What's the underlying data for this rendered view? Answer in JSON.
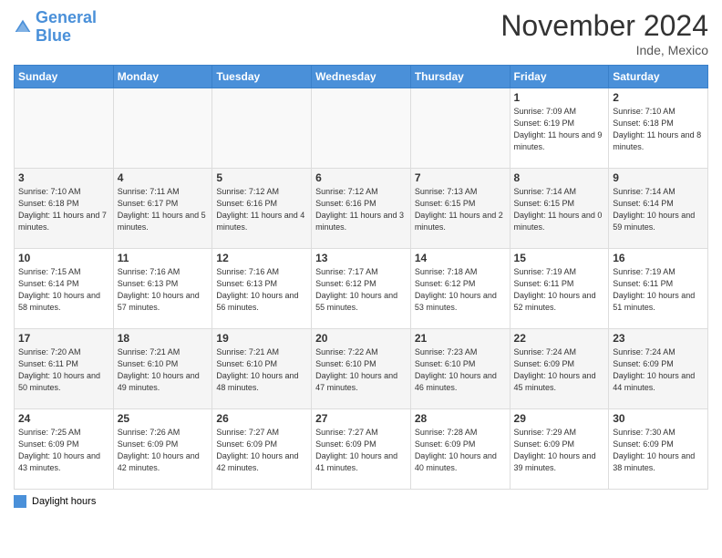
{
  "header": {
    "logo_line1": "General",
    "logo_line2": "Blue",
    "title": "November 2024",
    "location": "Inde, Mexico"
  },
  "days_of_week": [
    "Sunday",
    "Monday",
    "Tuesday",
    "Wednesday",
    "Thursday",
    "Friday",
    "Saturday"
  ],
  "weeks": [
    {
      "days": [
        {
          "num": "",
          "info": ""
        },
        {
          "num": "",
          "info": ""
        },
        {
          "num": "",
          "info": ""
        },
        {
          "num": "",
          "info": ""
        },
        {
          "num": "",
          "info": ""
        },
        {
          "num": "1",
          "info": "Sunrise: 7:09 AM\nSunset: 6:19 PM\nDaylight: 11 hours and 9 minutes."
        },
        {
          "num": "2",
          "info": "Sunrise: 7:10 AM\nSunset: 6:18 PM\nDaylight: 11 hours and 8 minutes."
        }
      ]
    },
    {
      "days": [
        {
          "num": "3",
          "info": "Sunrise: 7:10 AM\nSunset: 6:18 PM\nDaylight: 11 hours and 7 minutes."
        },
        {
          "num": "4",
          "info": "Sunrise: 7:11 AM\nSunset: 6:17 PM\nDaylight: 11 hours and 5 minutes."
        },
        {
          "num": "5",
          "info": "Sunrise: 7:12 AM\nSunset: 6:16 PM\nDaylight: 11 hours and 4 minutes."
        },
        {
          "num": "6",
          "info": "Sunrise: 7:12 AM\nSunset: 6:16 PM\nDaylight: 11 hours and 3 minutes."
        },
        {
          "num": "7",
          "info": "Sunrise: 7:13 AM\nSunset: 6:15 PM\nDaylight: 11 hours and 2 minutes."
        },
        {
          "num": "8",
          "info": "Sunrise: 7:14 AM\nSunset: 6:15 PM\nDaylight: 11 hours and 0 minutes."
        },
        {
          "num": "9",
          "info": "Sunrise: 7:14 AM\nSunset: 6:14 PM\nDaylight: 10 hours and 59 minutes."
        }
      ]
    },
    {
      "days": [
        {
          "num": "10",
          "info": "Sunrise: 7:15 AM\nSunset: 6:14 PM\nDaylight: 10 hours and 58 minutes."
        },
        {
          "num": "11",
          "info": "Sunrise: 7:16 AM\nSunset: 6:13 PM\nDaylight: 10 hours and 57 minutes."
        },
        {
          "num": "12",
          "info": "Sunrise: 7:16 AM\nSunset: 6:13 PM\nDaylight: 10 hours and 56 minutes."
        },
        {
          "num": "13",
          "info": "Sunrise: 7:17 AM\nSunset: 6:12 PM\nDaylight: 10 hours and 55 minutes."
        },
        {
          "num": "14",
          "info": "Sunrise: 7:18 AM\nSunset: 6:12 PM\nDaylight: 10 hours and 53 minutes."
        },
        {
          "num": "15",
          "info": "Sunrise: 7:19 AM\nSunset: 6:11 PM\nDaylight: 10 hours and 52 minutes."
        },
        {
          "num": "16",
          "info": "Sunrise: 7:19 AM\nSunset: 6:11 PM\nDaylight: 10 hours and 51 minutes."
        }
      ]
    },
    {
      "days": [
        {
          "num": "17",
          "info": "Sunrise: 7:20 AM\nSunset: 6:11 PM\nDaylight: 10 hours and 50 minutes."
        },
        {
          "num": "18",
          "info": "Sunrise: 7:21 AM\nSunset: 6:10 PM\nDaylight: 10 hours and 49 minutes."
        },
        {
          "num": "19",
          "info": "Sunrise: 7:21 AM\nSunset: 6:10 PM\nDaylight: 10 hours and 48 minutes."
        },
        {
          "num": "20",
          "info": "Sunrise: 7:22 AM\nSunset: 6:10 PM\nDaylight: 10 hours and 47 minutes."
        },
        {
          "num": "21",
          "info": "Sunrise: 7:23 AM\nSunset: 6:10 PM\nDaylight: 10 hours and 46 minutes."
        },
        {
          "num": "22",
          "info": "Sunrise: 7:24 AM\nSunset: 6:09 PM\nDaylight: 10 hours and 45 minutes."
        },
        {
          "num": "23",
          "info": "Sunrise: 7:24 AM\nSunset: 6:09 PM\nDaylight: 10 hours and 44 minutes."
        }
      ]
    },
    {
      "days": [
        {
          "num": "24",
          "info": "Sunrise: 7:25 AM\nSunset: 6:09 PM\nDaylight: 10 hours and 43 minutes."
        },
        {
          "num": "25",
          "info": "Sunrise: 7:26 AM\nSunset: 6:09 PM\nDaylight: 10 hours and 42 minutes."
        },
        {
          "num": "26",
          "info": "Sunrise: 7:27 AM\nSunset: 6:09 PM\nDaylight: 10 hours and 42 minutes."
        },
        {
          "num": "27",
          "info": "Sunrise: 7:27 AM\nSunset: 6:09 PM\nDaylight: 10 hours and 41 minutes."
        },
        {
          "num": "28",
          "info": "Sunrise: 7:28 AM\nSunset: 6:09 PM\nDaylight: 10 hours and 40 minutes."
        },
        {
          "num": "29",
          "info": "Sunrise: 7:29 AM\nSunset: 6:09 PM\nDaylight: 10 hours and 39 minutes."
        },
        {
          "num": "30",
          "info": "Sunrise: 7:30 AM\nSunset: 6:09 PM\nDaylight: 10 hours and 38 minutes."
        }
      ]
    }
  ],
  "legend": {
    "daylight_label": "Daylight hours"
  }
}
